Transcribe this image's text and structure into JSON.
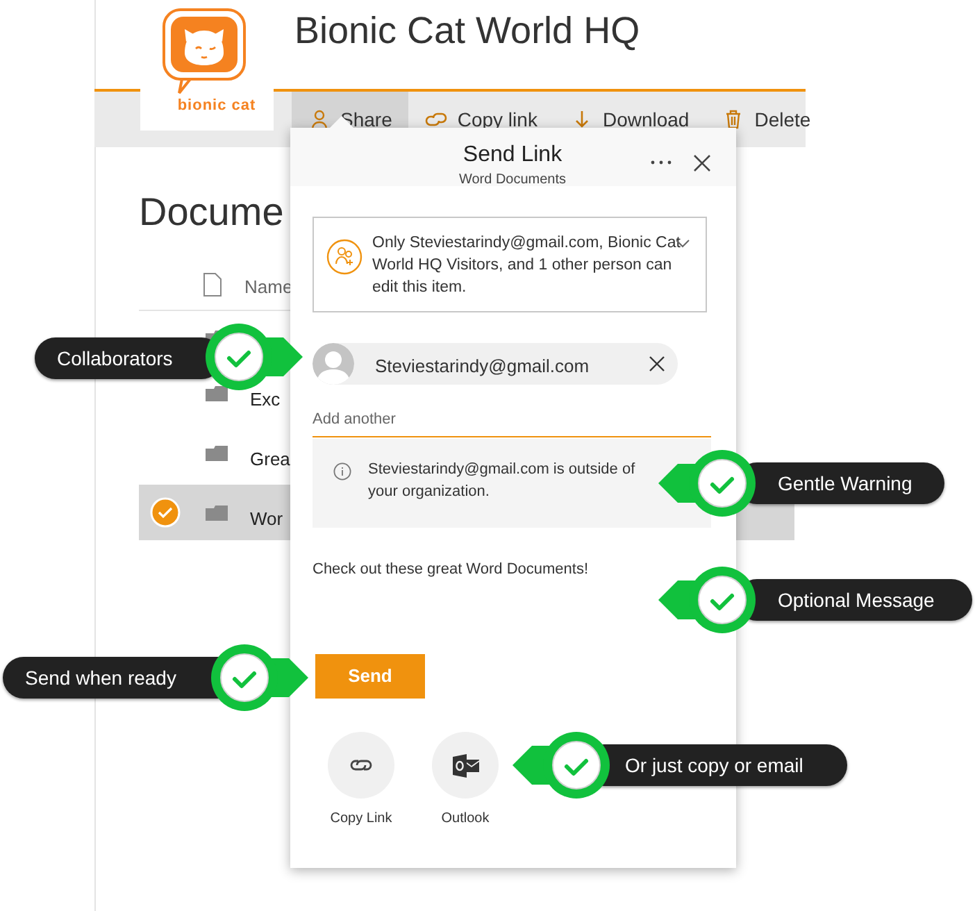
{
  "site": {
    "title": "Bionic Cat World HQ",
    "logo_text": "bionic cat"
  },
  "toolbar": [
    {
      "label": "Share",
      "kind": "share",
      "selected": true
    },
    {
      "label": "Copy link",
      "kind": "link",
      "selected": false
    },
    {
      "label": "Download",
      "kind": "download",
      "selected": false
    },
    {
      "label": "Delete",
      "kind": "delete",
      "selected": false
    }
  ],
  "page_heading": "Docume",
  "list": {
    "column": "Name",
    "rows": [
      {
        "name": "Exc",
        "selected": false
      },
      {
        "name": "Grea",
        "selected": false
      },
      {
        "name": "Wor",
        "selected": true
      }
    ]
  },
  "panel": {
    "title": "Send Link",
    "subtitle": "Word Documents",
    "permission": "Only Steviestarindy@gmail.com, Bionic Cat World HQ Visitors, and 1 other person can edit this item.",
    "recipient": "Steviestarindy@gmail.com",
    "add_placeholder": "Add another",
    "warning": "Steviestarindy@gmail.com is outside of your organization.",
    "message": "Check out these great Word Documents!",
    "send": "Send",
    "options": [
      {
        "label": "Copy Link",
        "kind": "link"
      },
      {
        "label": "Outlook",
        "kind": "outlook"
      }
    ]
  },
  "callouts": [
    {
      "label": "Collaborators"
    },
    {
      "label": "Gentle Warning"
    },
    {
      "label": "Optional Message"
    },
    {
      "label": "Send when ready"
    },
    {
      "label": "Or just copy or email"
    }
  ]
}
